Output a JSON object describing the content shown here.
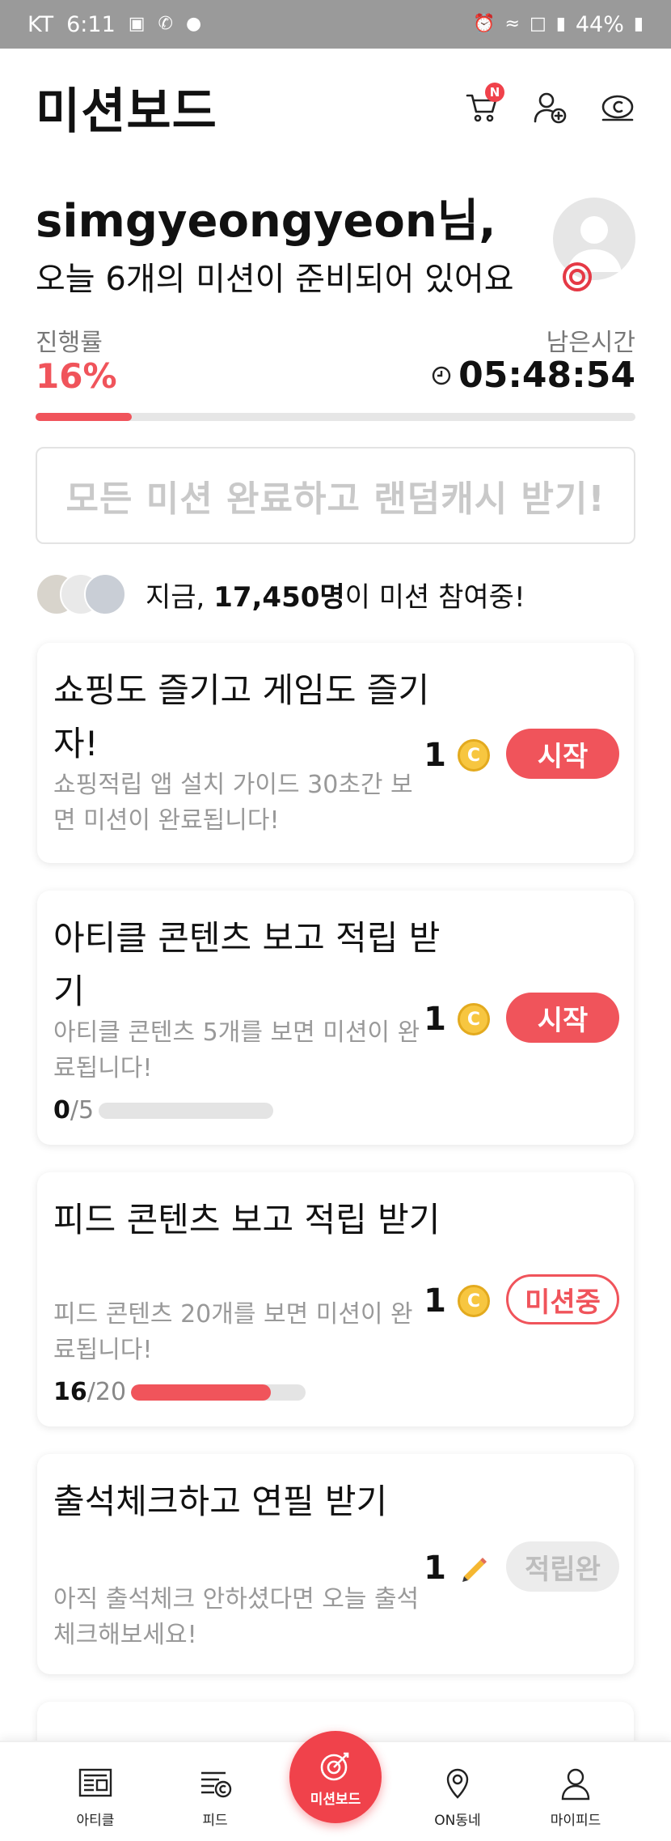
{
  "status_bar": {
    "carrier": "KT",
    "time": "6:11",
    "battery": "44%"
  },
  "header": {
    "title": "미션보드",
    "cart_badge": "N",
    "icons": [
      "cart-icon",
      "add-friend-icon",
      "cash-icon"
    ]
  },
  "greeting": {
    "name": "simgyeongyeon님,",
    "subtitle": "오늘 6개의 미션이 준비되어 있어요"
  },
  "progress": {
    "label": "진행률",
    "value": "16%",
    "fraction": 0.16,
    "remaining_label": "남은시간",
    "remaining_time": "05:48:54"
  },
  "banner": {
    "text": "모든 미션 완료하고 랜덤캐시 받기!"
  },
  "participants": {
    "prefix": "지금, ",
    "count": "17,450명",
    "suffix": "이 미션 참여중!"
  },
  "missions": [
    {
      "title": "쇼핑도 즐기고 게임도 즐기자!",
      "description": "쇼핑적립 앱 설치 가이드 30초간 보면 미션이 완료됩니다!",
      "reward": "1",
      "reward_type": "coin",
      "status": "시작"
    },
    {
      "title": "아티클 콘텐츠 보고 적립 받기",
      "description": "아티클 콘텐츠 5개를 보면 미션이 완료됩니다!",
      "reward": "1",
      "reward_type": "coin",
      "status": "시작",
      "progress_done": "0",
      "progress_total": "/5",
      "progress_fraction": 0
    },
    {
      "title": "피드 콘텐츠 보고 적립 받기",
      "description": "피드 콘텐츠 20개를 보면 미션이 완료됩니다!",
      "reward": "1",
      "reward_type": "coin",
      "status": "미션중",
      "progress_done": "16",
      "progress_total": "/20",
      "progress_fraction": 0.8
    },
    {
      "title": "출석체크하고 연필 받기",
      "description": "아직 출석체크 안하셨다면 오늘 출석체크해보세요!",
      "reward": "1",
      "reward_type": "pencil",
      "status": "적립완"
    }
  ],
  "bottom_nav": {
    "items": [
      "아티클",
      "피드",
      "미션보드",
      "ON동네",
      "마이피드"
    ]
  },
  "colors": {
    "accent": "#f0545b",
    "coin": "#f7c640"
  }
}
